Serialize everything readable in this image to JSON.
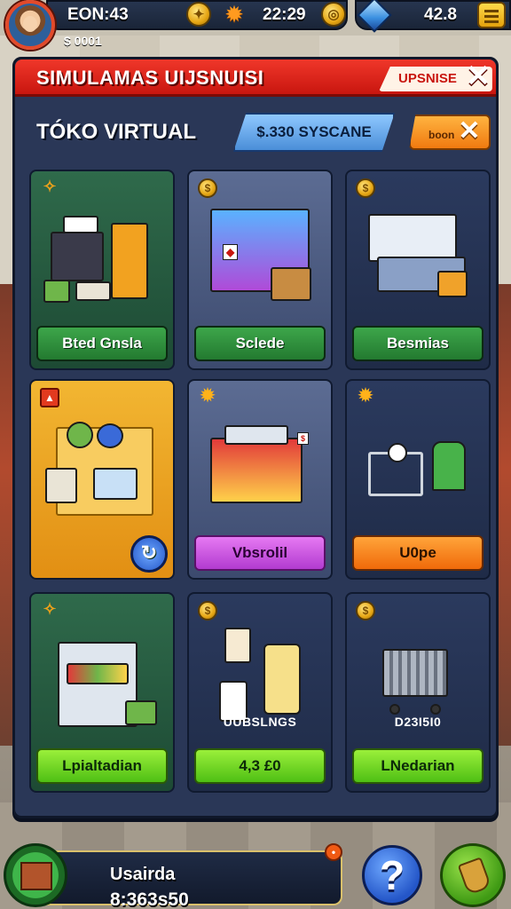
{
  "hud": {
    "player_label": "EON:43",
    "time": "22:29",
    "gem_count": "42.8",
    "sub_text": "$ 0001"
  },
  "panel": {
    "title": "SIMULAMAS UIJSNUISI",
    "title_right": "UPSNISE",
    "store_title": "TÓKO VIRTUAL",
    "search_pill": "$.330 SYSCANE",
    "orange_pill": "boon"
  },
  "cards": [
    {
      "button": "Bted Gnsla",
      "label": ""
    },
    {
      "button": "Sclede",
      "label": ""
    },
    {
      "button": "Besmias",
      "label": ""
    },
    {
      "button": "",
      "label": ""
    },
    {
      "button": "Vbsrolil",
      "label": ""
    },
    {
      "button": "U0pe",
      "label": ""
    },
    {
      "button": "Lpialtadian",
      "label": ""
    },
    {
      "button": "4,3 £0",
      "label": "UUBSLNGS"
    },
    {
      "button": "LNedarian",
      "label": "D23I5I0"
    }
  ],
  "bottom": {
    "name": "Usairda",
    "value": "8:363s50"
  },
  "colors": {
    "title_red": "#e0251b",
    "panel_navy": "#2a3757",
    "button_green": "#2f8f3b",
    "button_lime": "#7ad825",
    "button_purple": "#d25ae6",
    "button_orange": "#f58a1f"
  }
}
